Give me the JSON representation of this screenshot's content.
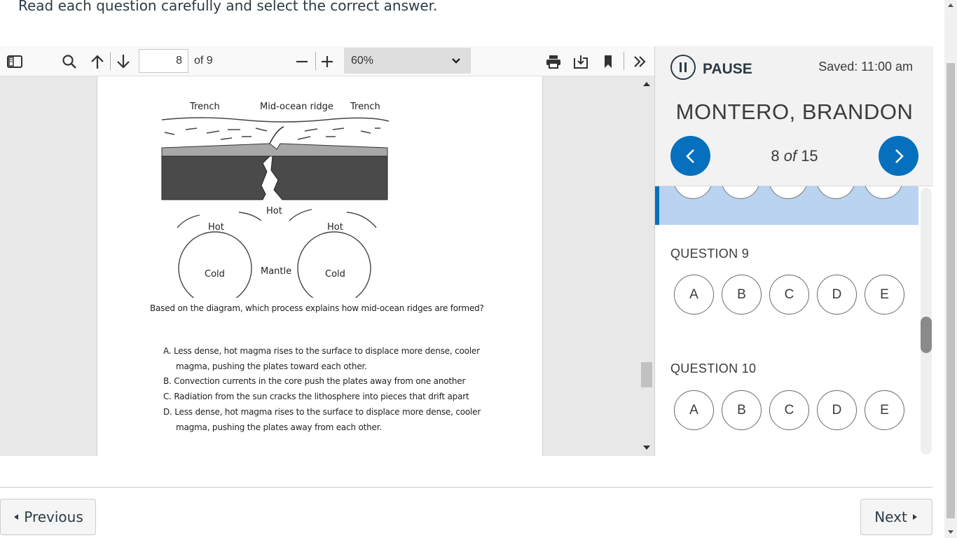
{
  "instructions": "Read each question carefully and select the correct answer.",
  "pdf_toolbar": {
    "page_current": "8",
    "page_total_label": "of 9",
    "zoom_value": "60%",
    "icons": [
      "sidebar-toggle-icon",
      "search-icon",
      "arrow-up-icon",
      "arrow-down-icon",
      "minus-icon",
      "plus-icon",
      "print-icon",
      "download-icon",
      "bookmark-icon",
      "double-chevron-right-icon"
    ]
  },
  "pdf_page": {
    "diagram_labels": {
      "trench_left": "Trench",
      "ridge": "Mid-ocean ridge",
      "trench_right": "Trench",
      "hot_top": "Hot",
      "hot_left": "Hot",
      "hot_right": "Hot",
      "cold_left": "Cold",
      "mantle": "Mantle",
      "cold_right": "Cold"
    },
    "question": "Based on the diagram, which process explains how mid-ocean ridges are formed?",
    "choices": {
      "a1": "A.  Less dense, hot magma rises to the surface to displace more dense, cooler",
      "a2": "magma, pushing the plates toward each other.",
      "b": "B.  Convection currents in the core push the plates away from one another",
      "c": "C.  Radiation from the sun cracks the lithosphere into pieces that drift apart",
      "d1": "D.  Less dense, hot magma rises to the surface to displace more dense, cooler",
      "d2": "magma, pushing the plates away from each other."
    }
  },
  "panel": {
    "pause_label": "PAUSE",
    "saved": "Saved: 11:00 am",
    "student_name": "MONTERO, BRANDON",
    "counter_num": "8",
    "counter_of": "of",
    "counter_total": "15",
    "questions": [
      {
        "title": "QUESTION 9",
        "options": [
          "A",
          "B",
          "C",
          "D",
          "E"
        ]
      },
      {
        "title": "QUESTION 10",
        "options": [
          "A",
          "B",
          "C",
          "D",
          "E"
        ]
      }
    ]
  },
  "footer": {
    "previous": "Previous",
    "next": "Next"
  },
  "colors": {
    "accent": "#0770be",
    "selected_row": "#b9d3f0"
  }
}
